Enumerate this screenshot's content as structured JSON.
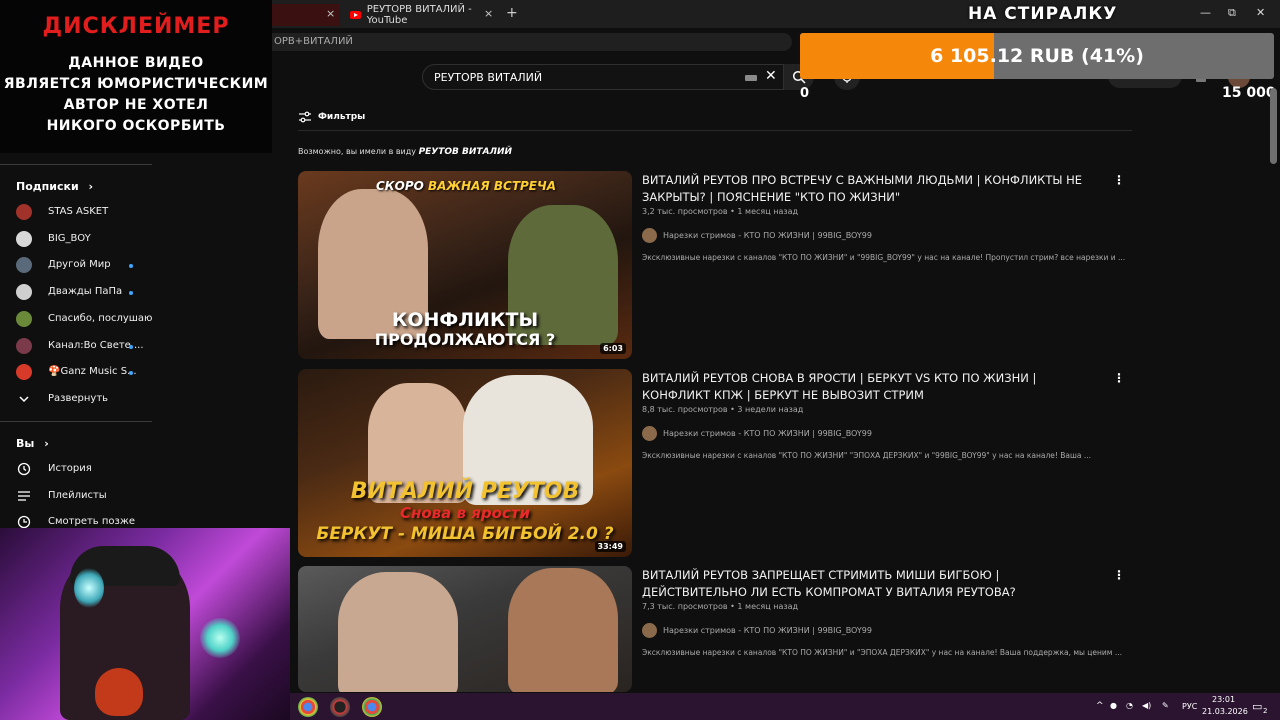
{
  "browser": {
    "prev_tab_close": "×",
    "active_tab_title": "РЕУТОРВ ВИТАЛИЙ - YouTube",
    "active_tab_close": "×",
    "new_tab": "+",
    "url_fragment": "ОРВ+ВИТАЛИЙ",
    "window_controls": {
      "minimize": "—",
      "restore": "⧉",
      "close": "✕"
    }
  },
  "overlay": {
    "disclaimer": {
      "heading": "ДИСКЛЕЙМЕР",
      "lines": [
        "ДАННОЕ ВИДЕО",
        "ЯВЛЯЕТСЯ ЮМОРИСТИЧЕСКИМ",
        "АВТОР НЕ ХОТЕЛ",
        "НИКОГО ОСКОРБИТЬ"
      ]
    },
    "donation": {
      "title": "НА СТИРАЛКУ",
      "amount_text": "6 105.12 RUB (41%)",
      "progress_fraction": 0.41,
      "fill_color": "#f5870a",
      "counter_left": "0",
      "counter_right": "15 000"
    }
  },
  "youtube": {
    "search_value": "РЕУТОРВ ВИТАЛИЙ",
    "clear_icon": "✕",
    "filters_label": "Фильтры",
    "did_you_mean_prefix": "Возможно, вы имели в виду",
    "did_you_mean_query": "РЕУТОВ ВИТАЛИЙ",
    "sidebar": {
      "subscriptions_heading": "Подписки",
      "heading_chevron": "›",
      "subscriptions": [
        {
          "name": "STAS ASKET",
          "color": "#a0322a",
          "new": false
        },
        {
          "name": "BIG_BOY",
          "color": "#d8d8d8",
          "new": false
        },
        {
          "name": "Другой Мир",
          "color": "#5a6a7a",
          "new": true
        },
        {
          "name": "Дважды ПаПа",
          "color": "#cfcfcf",
          "new": true
        },
        {
          "name": "Спасибо, послушаю",
          "color": "#6a8a3a",
          "new": false
        },
        {
          "name": "Канал:Во Свете ...",
          "color": "#7a3a4a",
          "new": true
        },
        {
          "name": "🍄Ganz Music S...",
          "color": "#d83a2a",
          "new": true
        }
      ],
      "expand_label": "Развернуть",
      "you_heading": "Вы",
      "you_items": [
        {
          "label": "История",
          "icon": "history-icon"
        },
        {
          "label": "Плейлисты",
          "icon": "playlist-icon"
        },
        {
          "label": "Смотреть позже",
          "icon": "watch-later-icon"
        }
      ]
    },
    "results": [
      {
        "title": "ВИТАЛИЙ РЕУТОВ ПРО ВСТРЕЧУ С ВАЖНЫМИ ЛЮДЬМИ | КОНФЛИКТЫ НЕ ЗАКРЫТЫ? | ПОЯСНЕНИЕ \"КТО ПО ЖИЗНИ\"",
        "views": "3,2 тыс. просмотров",
        "age": "1 месяц назад",
        "channel": "Нарезки стримов - КТО ПО ЖИЗНИ | 99BIG_BOY99",
        "description": "Эксклюзивные нарезки с каналов \"КТО ПО ЖИЗНИ\" и \"99BIG_BOY99\" у нас на канале! Пропустил стрим? все нарезки и ...",
        "duration": "6:03",
        "thumb_top_prefix": "СКОРО",
        "thumb_top_highlight": "ВАЖНАЯ ВСТРЕЧА",
        "thumb_line1": "КОНФЛИКТЫ",
        "thumb_line2": "ПРОДОЛЖАЮТСЯ ?"
      },
      {
        "title": "ВИТАЛИЙ РЕУТОВ СНОВА В ЯРОСТИ | БЕРКУТ VS КТО ПО ЖИЗНИ | КОНФЛИКТ КПЖ | БЕРКУТ НЕ ВЫВОЗИТ СТРИМ",
        "views": "8,8 тыс. просмотров",
        "age": "3 недели назад",
        "channel": "Нарезки стримов - КТО ПО ЖИЗНИ | 99BIG_BOY99",
        "description": "Эксклюзивные нарезки с каналов \"КТО ПО ЖИЗНИ\" \"ЭПОХА ДЕРЗКИХ\" и \"99BIG_BOY99\" у нас на канале! Ваша ...",
        "duration": "33:49",
        "thumb_line1": "ВИТАЛИЙ РЕУТОВ",
        "thumb_line2": "Снова в ярости",
        "thumb_line3": "БЕРКУТ - МИША БИГБОЙ 2.0 ?"
      },
      {
        "title": "ВИТАЛИЙ РЕУТОВ ЗАПРЕЩАЕТ СТРИМИТЬ МИШИ БИГБОЮ | ДЕЙСТВИТЕЛЬНО ЛИ ЕСТЬ КОМПРОМАТ У ВИТАЛИЯ РЕУТОВА?",
        "views": "7,3 тыс. просмотров",
        "age": "1 месяц назад",
        "channel": "Нарезки стримов - КТО ПО ЖИЗНИ | 99BIG_BOY99",
        "description": "Эксклюзивные нарезки с каналов \"КТО ПО ЖИЗНИ\" и \"ЭПОХА ДЕРЗКИХ\" у нас на канале! Ваша поддержка, мы ценим ..."
      }
    ]
  },
  "taskbar": {
    "tray_chevron": "^",
    "language": "РУС",
    "time": "23:01",
    "date": "21.03.2026",
    "notifications_count": "2"
  }
}
